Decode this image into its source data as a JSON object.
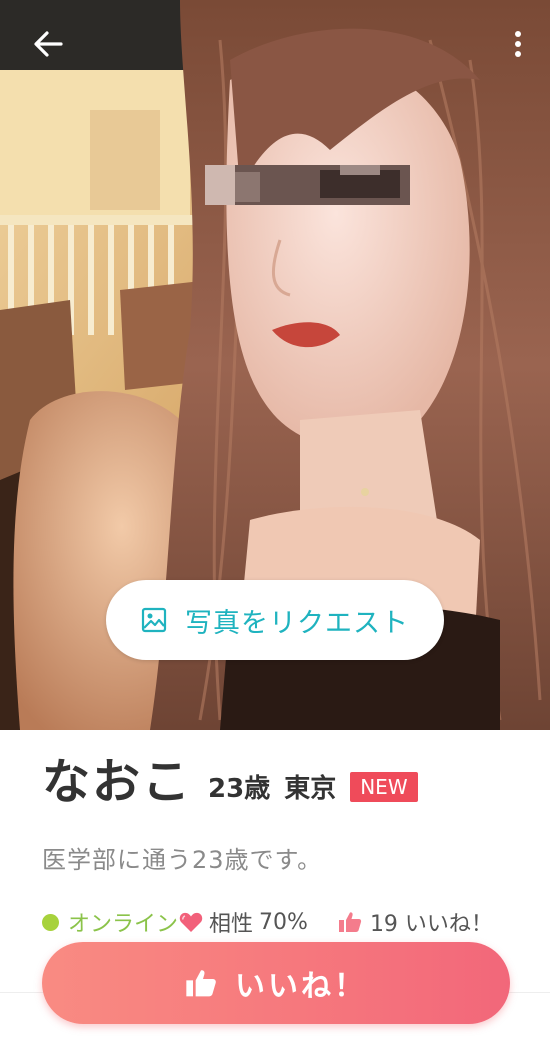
{
  "photo": {
    "request_label": "写真をリクエスト"
  },
  "profile": {
    "name": "なおこ",
    "age": "23歳",
    "city": "東京",
    "badge": "NEW",
    "bio": "医学部に通う23歳です。"
  },
  "status": {
    "online_label": "オンライン",
    "compat_label": "相性",
    "compat_value": "70%",
    "likes": "19 いいね！"
  },
  "actions": {
    "like_label": "いいね！"
  },
  "colors": {
    "accent_teal": "#1fb3bf",
    "badge_red": "#ef4b5a",
    "online_green": "#a7d23c",
    "like_pink": "#f6787d"
  }
}
